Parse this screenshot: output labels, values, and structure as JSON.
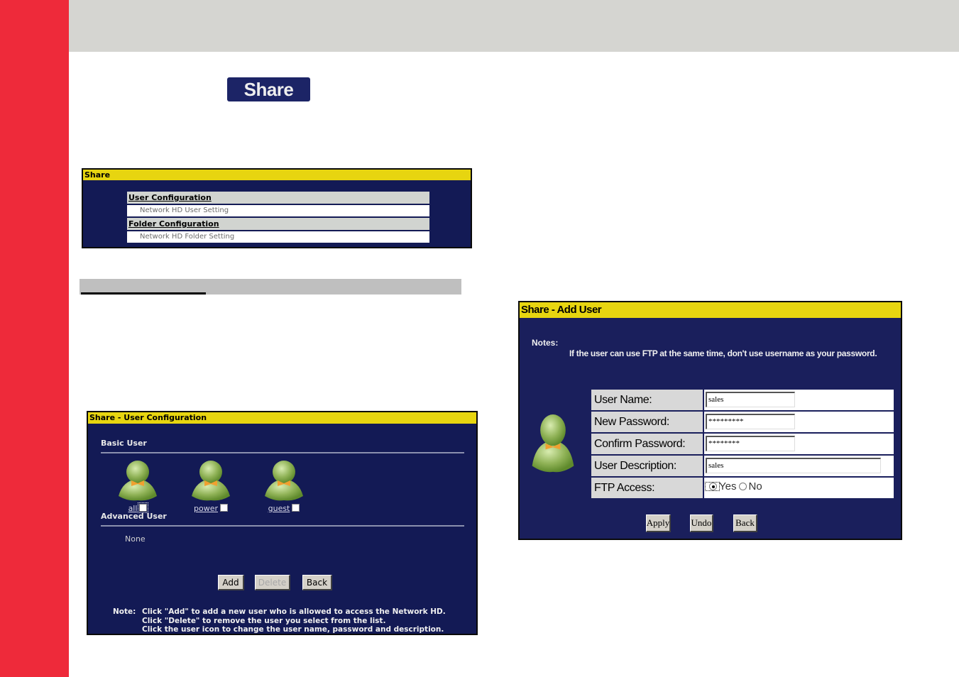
{
  "colors": {
    "sidebar_red": "#ee2a3a",
    "header_gray": "#d5d5d1",
    "panel_navy": "#131a55",
    "title_yellow": "#e7d510"
  },
  "badge": {
    "label": "Share"
  },
  "share_panel": {
    "title": "Share",
    "sections": [
      {
        "heading": "User Configuration",
        "item": "Network HD User Setting"
      },
      {
        "heading": "Folder Configuration",
        "item": "Network HD Folder Setting"
      }
    ]
  },
  "user_config_panel": {
    "title": "Share - User Configuration",
    "basic_user_label": "Basic User",
    "basic_users": [
      {
        "name": "all",
        "icon": "user-icon",
        "checked": false
      },
      {
        "name": "power",
        "icon": "user-icon",
        "checked": false
      },
      {
        "name": "guest",
        "icon": "user-icon",
        "checked": false
      }
    ],
    "advanced_user_label": "Advanced User",
    "advanced_users_empty": "None",
    "buttons": {
      "add": "Add",
      "delete": "Delete",
      "back": "Back"
    },
    "note_label": "Note:",
    "notes": [
      "Click \"Add\" to add a new user who is allowed to access the Network HD.",
      "Click \"Delete\" to remove the user you select from the list.",
      "Click the user icon to change the user name, password and description."
    ]
  },
  "add_user_panel": {
    "title": "Share - Add User",
    "notes_label": "Notes:",
    "notes_text": "If the user can use FTP at the same time, don't use username as your password.",
    "fields": {
      "user_name": {
        "label": "User Name:",
        "value": "sales"
      },
      "new_password": {
        "label": "New Password:",
        "value": "*********"
      },
      "confirm_password": {
        "label": "Confirm Password:",
        "value": "********"
      },
      "user_description": {
        "label": "User Description:",
        "value": "sales"
      },
      "ftp_access": {
        "label": "FTP Access:",
        "options": [
          "Yes",
          "No"
        ],
        "selected": "Yes"
      }
    },
    "buttons": {
      "apply": "Apply",
      "undo": "Undo",
      "back": "Back"
    }
  }
}
